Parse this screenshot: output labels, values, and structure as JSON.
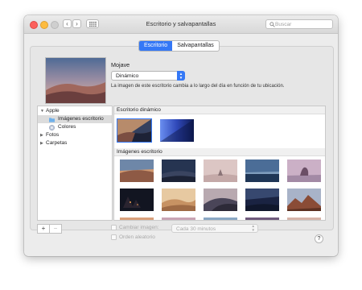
{
  "window": {
    "title": "Escritorio y salvapantallas"
  },
  "toolbar": {
    "back": "‹",
    "forward": "›"
  },
  "search": {
    "placeholder": "Buscar"
  },
  "tabs": [
    {
      "label": "Escritorio",
      "active": true
    },
    {
      "label": "Salvapantallas",
      "active": false
    }
  ],
  "wallpaper": {
    "name": "Mojave",
    "mode": "Dinámico",
    "description": "La imagen de este escritorio cambia a lo largo del día en función de tu ubicación."
  },
  "sidebar": {
    "items": [
      {
        "label": "Apple",
        "icon": "disclosure-triangle-down"
      },
      {
        "label": "Imágenes escritorio",
        "icon": "folder-icon",
        "selected": true
      },
      {
        "label": "Colores",
        "icon": "color-wheel-icon"
      },
      {
        "label": "Fotos",
        "icon": "disclosure-triangle-right"
      },
      {
        "label": "Carpetas",
        "icon": "disclosure-triangle-right"
      }
    ]
  },
  "sections": {
    "dynamic": "Escritorio dinámico",
    "images": "Imágenes escritorio"
  },
  "footer": {
    "add": "+",
    "remove": "−",
    "change_picture": "Cambiar imagen:",
    "interval": "Cada 30 minutos",
    "random_order": "Orden aleatorio",
    "help": "?"
  },
  "colors": {
    "accent": "#3478f6",
    "window_bg": "#ececec"
  }
}
